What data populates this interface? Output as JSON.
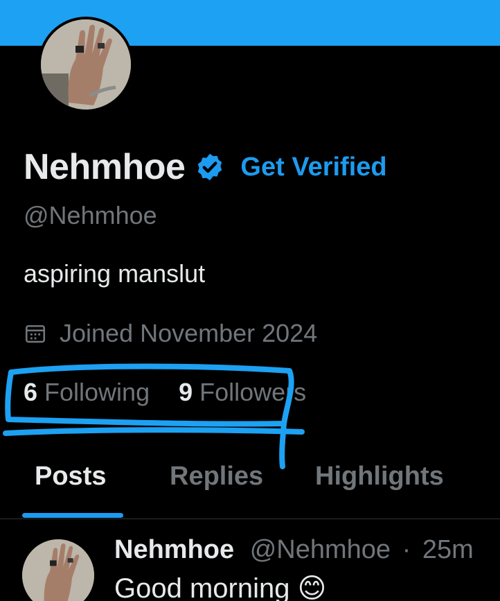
{
  "profile": {
    "display_name": "Nehmhoe",
    "get_verified_label": "Get Verified",
    "handle": "@Nehmhoe",
    "bio": "aspiring manslut",
    "joined": "Joined November 2024",
    "following_count": "6",
    "following_label": "Following",
    "followers_count": "9",
    "followers_label": "Followers"
  },
  "tabs": [
    {
      "label": "Posts",
      "active": true
    },
    {
      "label": "Replies",
      "active": false
    },
    {
      "label": "Highlights",
      "active": false
    }
  ],
  "post": {
    "author_name": "Nehmhoe",
    "author_handle": "@Nehmhoe",
    "separator": "·",
    "time": "25m",
    "text": "Good morning 😊"
  },
  "colors": {
    "banner": "#1da1f2",
    "accent": "#1d9bf0",
    "scribble": "#1da1f2",
    "background": "#000000"
  },
  "icons": {
    "verified": "verified-badge-icon",
    "calendar": "calendar-icon"
  }
}
